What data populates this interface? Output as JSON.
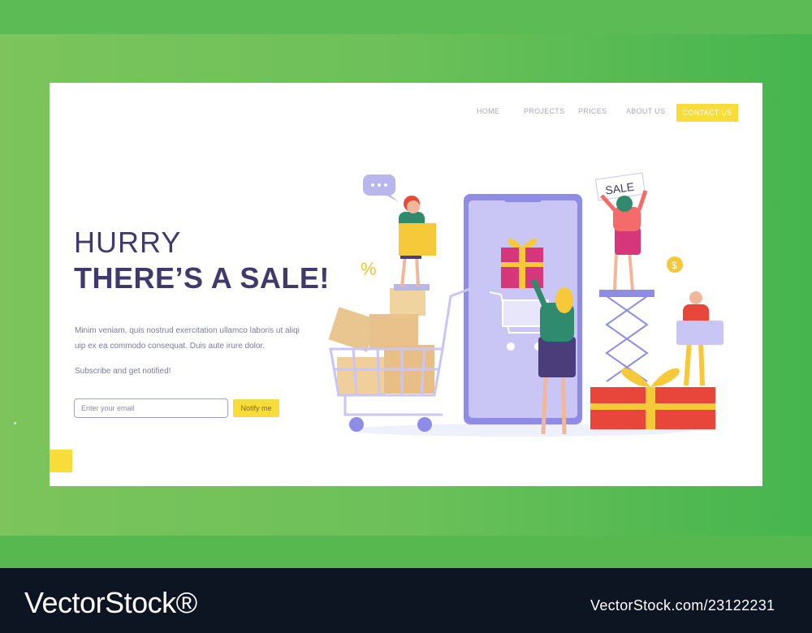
{
  "nav": {
    "items": [
      "HOME",
      "PROJECTS",
      "PRICES",
      "ABOUT US"
    ],
    "contact": "CONTACT US"
  },
  "hero": {
    "title_light": "HURRY",
    "title_bold": "THERE’S A SALE!",
    "description": "Minim veniam, quis nostrud exercitation ullamco laboris ut aliqi uip ex ea commodo consequat. Duis aute irure dolor.",
    "subscribe_text": "Subscribe and get notified!",
    "email_placeholder": "Enter your email",
    "notify_label": "Notify me"
  },
  "illustration": {
    "sale_sign": "SALE",
    "percent": "%",
    "coin": "$"
  },
  "footer": {
    "logo": "VectorStock®",
    "image_id": "VectorStock.com/23122231"
  },
  "colors": {
    "accent_yellow": "#f7dc3a",
    "title_navy": "#3f3a6b",
    "background_green": "#6cc05a",
    "footer_dark": "#0d1523"
  }
}
